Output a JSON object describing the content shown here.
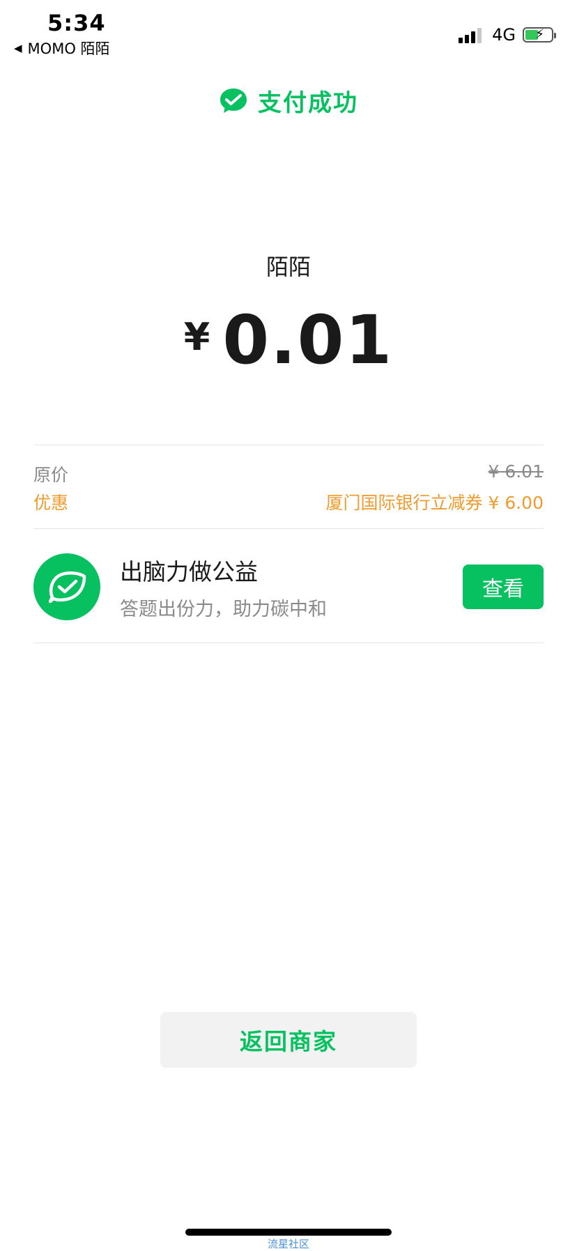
{
  "status_bar": {
    "time": "5:34",
    "back_app": "MOMO 陌陌",
    "network": "4G"
  },
  "header": {
    "title": "支付成功",
    "icon": "wechat-pay-check-icon"
  },
  "payment": {
    "merchant": "陌陌",
    "currency_symbol": "¥",
    "amount": "0.01"
  },
  "pricing": {
    "original_label": "原价",
    "original_value": "¥ 6.01",
    "discount_label": "优惠",
    "discount_value": "厦门国际银行立减券 ¥ 6.00"
  },
  "promo": {
    "title": "出脑力做公益",
    "subtitle": "答题出份力，助力碳中和",
    "button_label": "查看",
    "icon": "leaf-check-icon"
  },
  "footer": {
    "return_button": "返回商家",
    "watermark": "流星社区"
  },
  "colors": {
    "brand_green": "#07c160",
    "discount_orange": "#ef9b2d",
    "muted_gray": "#8a8a8a"
  }
}
